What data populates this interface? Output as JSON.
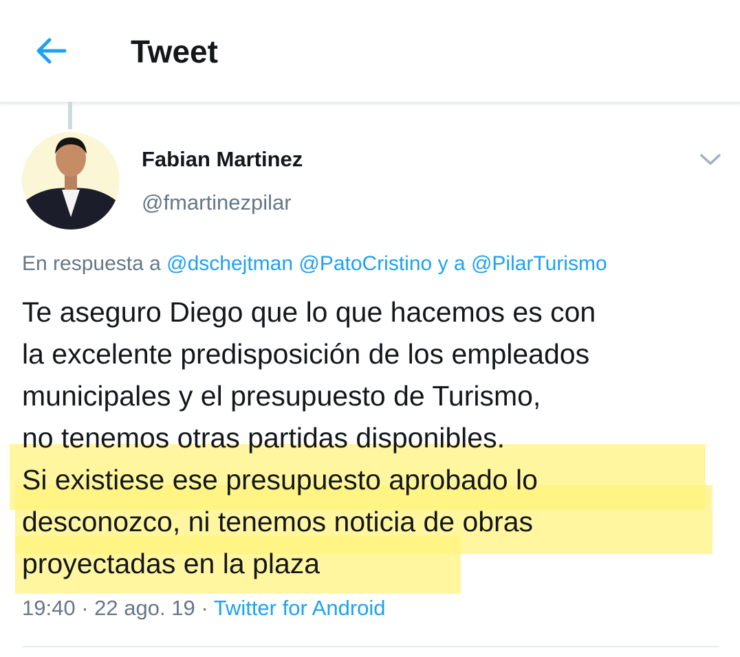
{
  "header": {
    "title": "Tweet",
    "back_icon": "arrow-left-icon"
  },
  "colors": {
    "accent": "#1da1f2",
    "muted": "#657786",
    "text": "#14171a",
    "highlight": "#fff27a"
  },
  "tweet": {
    "author_name": "Fabian Martinez",
    "author_handle": "@fmartinezpilar",
    "reply_prefix": "En respuesta a",
    "reply_mentions": [
      "@dschejtman",
      "@PatoCristino"
    ],
    "reply_connector": "y a",
    "reply_last_mention": "@PilarTurismo",
    "body": "Te aseguro Diego que lo que hacemos es con\nla excelente predisposición de los empleados\nmunicipales y el presupuesto de Turismo,\nno tenemos otras partidas disponibles.\nSi existiese ese presupuesto aprobado lo\ndesconozco, ni tenemos noticia de obras\nproyectadas en la plaza",
    "time": "19:40",
    "separator": "·",
    "date": "22 ago. 19",
    "source": "Twitter for Android"
  }
}
